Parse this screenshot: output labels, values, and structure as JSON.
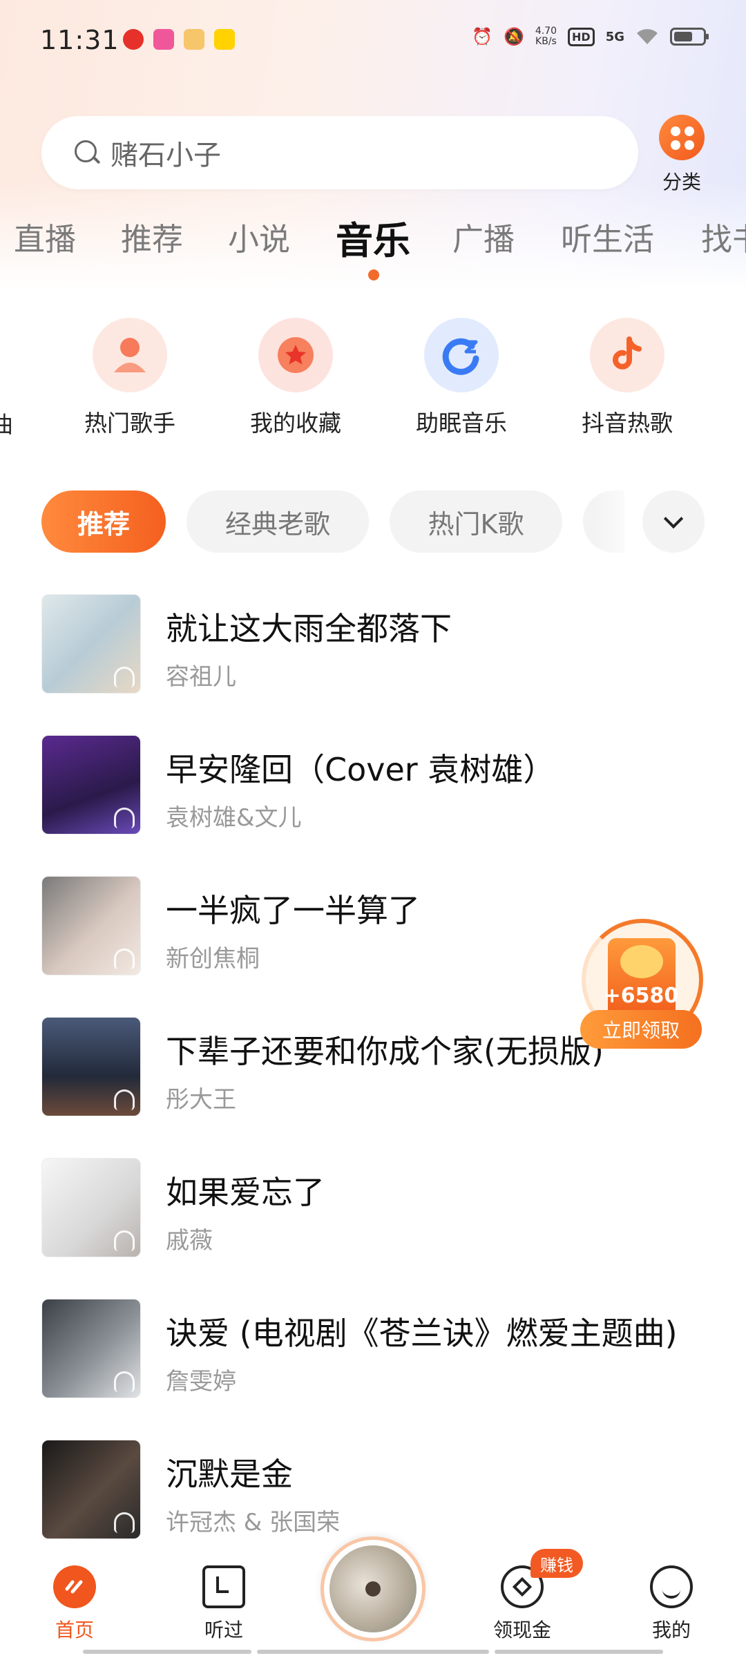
{
  "status_bar": {
    "time": "11:31",
    "net_speed_value": "4.70",
    "net_speed_unit": "KB/s",
    "hd": "HD",
    "signal": "5G"
  },
  "search": {
    "placeholder": "赌石小子"
  },
  "category": {
    "label": "分类"
  },
  "tabs": [
    "直播",
    "推荐",
    "小说",
    "音乐",
    "广播",
    "听生活",
    "找书"
  ],
  "active_tab": "音乐",
  "quick_entries": {
    "partial": "曲",
    "items": [
      {
        "label": "热门歌手",
        "icon": "singer-icon"
      },
      {
        "label": "我的收藏",
        "icon": "star-icon"
      },
      {
        "label": "助眠音乐",
        "icon": "sleep-icon"
      },
      {
        "label": "抖音热歌",
        "icon": "douyin-icon"
      }
    ]
  },
  "chips": [
    "推荐",
    "经典老歌",
    "热门K歌"
  ],
  "songs": [
    {
      "title": "就让这大雨全都落下",
      "artist": "容祖儿"
    },
    {
      "title": "早安隆回（Cover 袁树雄）",
      "artist": "袁树雄&文儿"
    },
    {
      "title": "一半疯了一半算了",
      "artist": "新创焦桐"
    },
    {
      "title": "下辈子还要和你成个家(无损版)",
      "artist": "彤大王"
    },
    {
      "title": "如果爱忘了",
      "artist": "戚薇"
    },
    {
      "title": "诀爱 (电视剧《苍兰诀》燃爱主题曲)",
      "artist": "詹雯婷"
    },
    {
      "title": "沉默是金",
      "artist": "许冠杰 & 张国荣"
    }
  ],
  "reward": {
    "amount": "+6580",
    "button": "立即领取"
  },
  "bottom_nav": {
    "items": [
      {
        "label": "首页"
      },
      {
        "label": "听过"
      },
      {
        "label": "领现金"
      },
      {
        "label": "我的"
      }
    ],
    "earn_badge": "赚钱"
  },
  "colors": {
    "accent": "#f36b2a"
  }
}
